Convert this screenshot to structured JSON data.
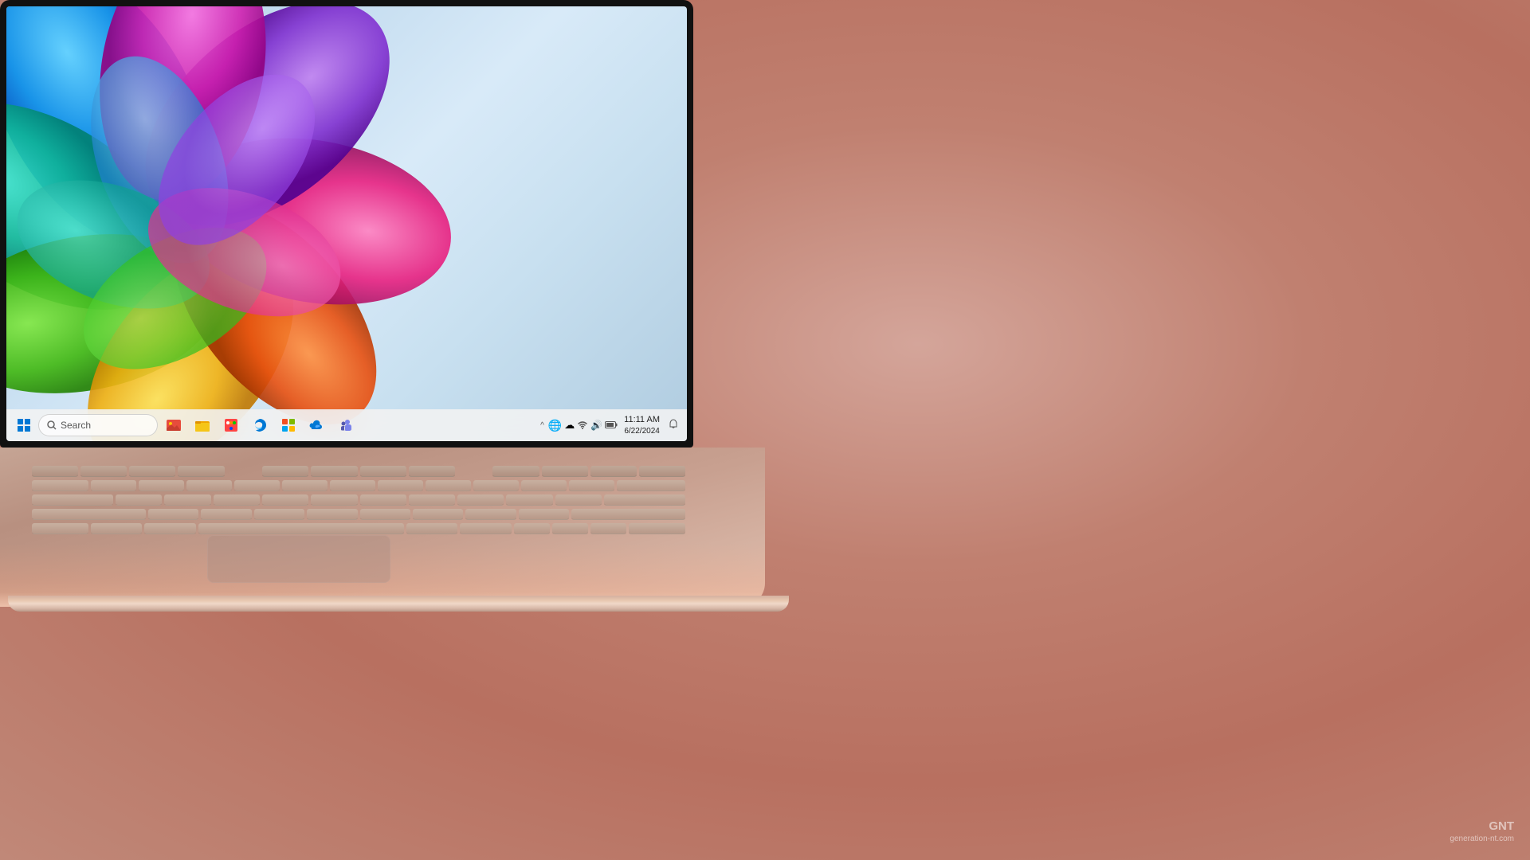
{
  "background": {
    "color_left": "#c8a090",
    "color_right": "#c09090"
  },
  "screen": {
    "wallpaper_colors": [
      "#b8d4e8",
      "#c5ddf0",
      "#d8eaf8"
    ],
    "taskbar": {
      "search_placeholder": "Search",
      "time": "11:11 AM",
      "date": "6/22/2024",
      "apps": [
        {
          "name": "photos",
          "label": "Photos",
          "color": "#e74c3c"
        },
        {
          "name": "file-explorer",
          "label": "File Explorer",
          "color": "#f39c12"
        },
        {
          "name": "paint",
          "label": "Paint",
          "color": "#e74c3c"
        },
        {
          "name": "edge",
          "label": "Edge",
          "color": "#0078d4"
        },
        {
          "name": "microsoft-store",
          "label": "Store",
          "color": "#0078d4"
        },
        {
          "name": "onedrive",
          "label": "OneDrive",
          "color": "#0078d4"
        },
        {
          "name": "teams",
          "label": "Teams",
          "color": "#6264a7"
        }
      ]
    }
  },
  "watermark": {
    "brand": "GNT",
    "site": "generation-nt.com"
  }
}
